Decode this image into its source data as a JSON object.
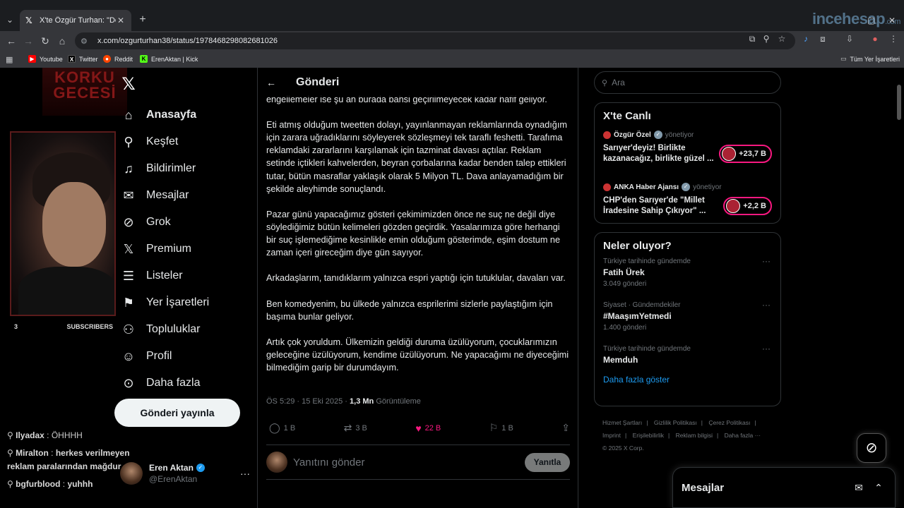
{
  "browser": {
    "tab_title": "X'te Özgür Turhan: \"Değerli ark",
    "url": "x.com/ozgurturhan38/status/1978468298082681026",
    "watermark_main": "incehesap",
    "watermark_sub": ".com",
    "bookmarks": [
      {
        "label": "Youtube",
        "icon": "youtube-icon",
        "color": "#ff0000"
      },
      {
        "label": "Twitter",
        "icon": "x-icon",
        "color": "#000000"
      },
      {
        "label": "Reddit",
        "icon": "reddit-icon",
        "color": "#ff4500"
      },
      {
        "label": "ErenAktan | Kick",
        "icon": "kick-icon",
        "color": "#53fc18"
      }
    ],
    "all_bookmarks": "Tüm Yer İşaretleri"
  },
  "stream_overlay": {
    "poster_text": "KORKU GECESİ",
    "subscriber_count": "3",
    "subscriber_label": "SUBSCRIBERS",
    "chat": [
      {
        "user": "Ilyadax",
        "message": "ÖHHHH"
      },
      {
        "user": "Miralton",
        "message": "herkes verilmeyen reklam paralarından mağdur"
      },
      {
        "user": "bgfurblood",
        "message": "yuhhh"
      }
    ]
  },
  "sidebar": {
    "items": [
      {
        "label": "Anasayfa",
        "icon": "home-icon"
      },
      {
        "label": "Keşfet",
        "icon": "search-icon"
      },
      {
        "label": "Bildirimler",
        "icon": "bell-icon"
      },
      {
        "label": "Mesajlar",
        "icon": "mail-icon"
      },
      {
        "label": "Grok",
        "icon": "grok-icon"
      },
      {
        "label": "Premium",
        "icon": "x-premium-icon"
      },
      {
        "label": "Listeler",
        "icon": "list-icon"
      },
      {
        "label": "Yer İşaretleri",
        "icon": "bookmark-icon"
      },
      {
        "label": "Topluluklar",
        "icon": "communities-icon"
      },
      {
        "label": "Profil",
        "icon": "person-icon"
      },
      {
        "label": "Daha fazla",
        "icon": "more-circle-icon"
      }
    ],
    "post_button": "Gönderi yayınla",
    "account": {
      "name": "Eren Aktan",
      "handle": "@ErenAktan"
    }
  },
  "main": {
    "header_title": "Gönderi",
    "paragraphs": [
      "engellemeler ise şu an burada bahsi geçirilmeyecek kadar hafif geliyor.",
      "Eti atmış olduğum tweetten dolayı, yayınlanmayan reklamlarında oynadığım için zarara uğradıklarını söyleyerek sözleşmeyi tek taraflı feshetti. Tarafıma reklamdaki zararlarını karşılamak için tazminat davası açtılar. Reklam setinde içtikleri kahvelerden, beyran çorbalarına kadar benden talep ettikleri tutar, bütün masraflar yaklaşık olarak 5 Milyon TL. Dava anlayamadığım bir şekilde aleyhimde sonuçlandı.",
      "Pazar günü yapacağımız gösteri çekimimizden önce ne suç ne değil diye söylediğimiz bütün kelimeleri gözden geçirdik. Yasalarımıza göre herhangi bir suç işlemediğime kesinlikle emin olduğum gösterimde, eşim dostum ne zaman içeri gireceğim diye gün sayıyor.",
      "Arkadaşlarım, tanıdıklarım yalnızca espri yaptığı için tutuklular, davaları var.",
      "Ben komedyenim, bu ülkede yalnızca esprilerimi sizlerle paylaştığım için başıma bunlar geliyor.",
      "Artık çok yoruldum. Ülkemizin geldiği duruma üzülüyorum, çocuklarımızın geleceğine üzülüyorum, kendime üzülüyorum. Ne yapacağımı ne diyeceğimi bilmediğim garip bir durumdayım."
    ],
    "time": "ÖS 5:29 · 15 Eki 2025 · ",
    "views_count": "1,3 Mn",
    "views_label": "Görüntüleme",
    "actions": {
      "replies": "1 B",
      "reposts": "3 B",
      "likes": "22 B",
      "bookmarks": "1 B"
    },
    "like_color": "#f91880",
    "reply_placeholder": "Yanıtını gönder",
    "reply_button": "Yanıtla"
  },
  "right": {
    "search_placeholder": "Ara",
    "live": {
      "title": "X'te Canlı",
      "items": [
        {
          "host": "Özgür Özel",
          "role": "yönetiyor",
          "title": "Sarıyer'deyiz! Birlikte kazanacağız, birlikte güzel ...",
          "count": "+23,7 B"
        },
        {
          "host": "ANKA Haber Ajansı",
          "role": "yönetiyor",
          "title": "CHP'den Sarıyer'de \"Millet İradesine Sahip Çıkıyor\" ...",
          "count": "+2,2 B"
        }
      ]
    },
    "trends": {
      "title": "Neler oluyor?",
      "items": [
        {
          "context": "Türkiye tarihinde gündemde",
          "name": "Fatih Ürek",
          "count": "3.049 gönderi"
        },
        {
          "context": "Siyaset · Gündemdekiler",
          "name": "#MaaşımYetmedi",
          "count": "1.400 gönderi"
        },
        {
          "context": "Türkiye tarihinde gündemde",
          "name": "Memduh",
          "count": ""
        }
      ],
      "show_more": "Daha fazla göster"
    },
    "footer": [
      "Hizmet Şartları",
      "Gizlilik Politikası",
      "Çerez Politikası",
      "Imprint",
      "Erişilebilirlik",
      "Reklam bilgisi",
      "Daha fazla ···",
      "© 2025 X Corp."
    ]
  },
  "messages_drawer": {
    "title": "Mesajlar"
  }
}
